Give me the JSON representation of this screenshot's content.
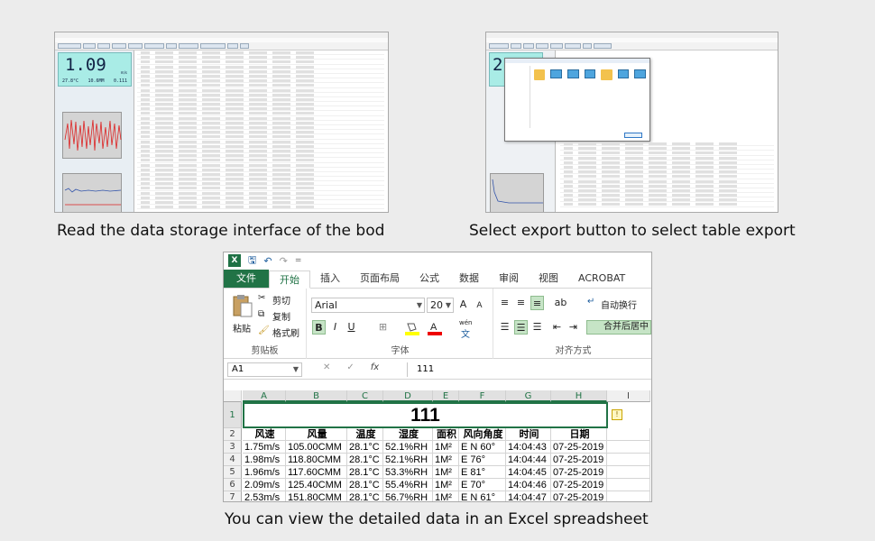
{
  "captions": {
    "top_left": "Read the data storage interface of the bod",
    "top_right": "Select export button to select table export",
    "bottom": "You can view the detailed data in an Excel spreadsheet"
  },
  "shot1": {
    "reading": "1.09",
    "unit": "m/s",
    "temp": "27.8°C",
    "volume": "10.6MM",
    "extra": "0.111"
  },
  "shot2": {
    "reading": "2."
  },
  "excel": {
    "qat": {
      "logo": "X",
      "save": "🖫",
      "undo": "↶",
      "redo": "↷",
      "more": "="
    },
    "tabs": [
      "文件",
      "开始",
      "插入",
      "页面布局",
      "公式",
      "数据",
      "审阅",
      "视图",
      "ACROBAT"
    ],
    "clipboard": {
      "paste": "粘贴",
      "cut": "剪切",
      "copy": "复制",
      "format_painter": "格式刷",
      "group": "剪贴板"
    },
    "font": {
      "name": "Arial",
      "size": "20",
      "grow": "A",
      "shrink": "A",
      "bold": "B",
      "italic": "I",
      "underline": "U",
      "wen": "wén",
      "group": "字体"
    },
    "alignment": {
      "wrap": "自动换行",
      "merge": "合并后居中",
      "group": "对齐方式"
    },
    "name_box": "A1",
    "formula": "111",
    "fx": "fx",
    "columns": [
      "A",
      "B",
      "C",
      "D",
      "E",
      "F",
      "G",
      "H",
      "I"
    ],
    "rows": [
      "1",
      "2",
      "3",
      "4",
      "5",
      "6",
      "7"
    ],
    "title": "111",
    "headers": [
      "风速",
      "风量",
      "温度",
      "湿度",
      "面积",
      "风向角度",
      "时间",
      "日期"
    ],
    "data": [
      [
        "1.75m/s",
        "105.00CMM",
        "28.1°C",
        "52.1%RH",
        "1M²",
        "E N 60°",
        "14:04:43",
        "07-25-2019"
      ],
      [
        "1.98m/s",
        "118.80CMM",
        "28.1°C",
        "52.1%RH",
        "1M²",
        "E 76°",
        "14:04:44",
        "07-25-2019"
      ],
      [
        "1.96m/s",
        "117.60CMM",
        "28.1°C",
        "53.3%RH",
        "1M²",
        "E 81°",
        "14:04:45",
        "07-25-2019"
      ],
      [
        "2.09m/s",
        "125.40CMM",
        "28.1°C",
        "55.4%RH",
        "1M²",
        "E 70°",
        "14:04:46",
        "07-25-2019"
      ],
      [
        "2.53m/s",
        "151.80CMM",
        "28.1°C",
        "56.7%RH",
        "1M²",
        "E N 61°",
        "14:04:47",
        "07-25-2019"
      ]
    ]
  }
}
